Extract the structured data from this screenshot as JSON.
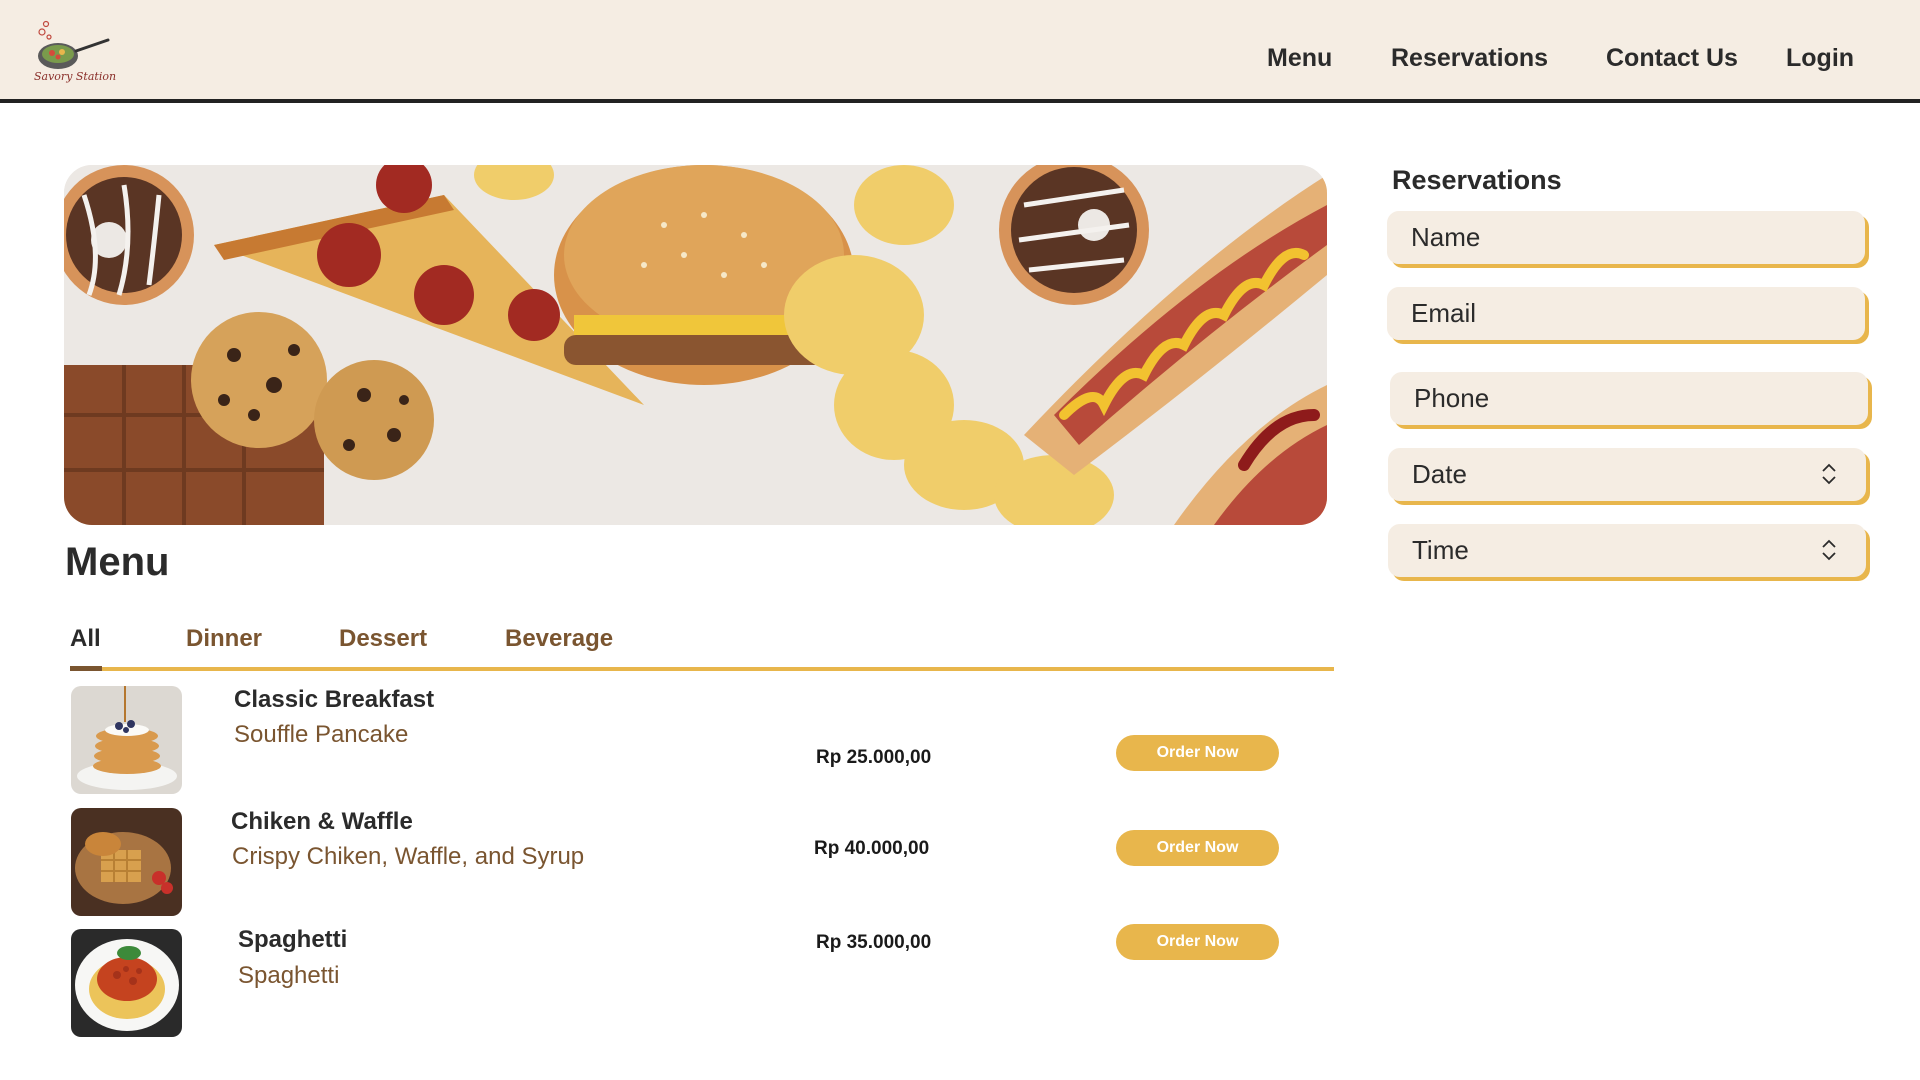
{
  "header": {
    "logo_text": "Savory Station",
    "nav": [
      "Menu",
      "Reservations",
      "Contact Us",
      "Login"
    ]
  },
  "menu": {
    "title": "Menu",
    "tabs": [
      "All",
      "Dinner",
      "Dessert",
      "Beverage"
    ],
    "active_tab": "All",
    "items": [
      {
        "name": "Classic Breakfast",
        "description": "Souffle Pancake",
        "price": "Rp 25.000,00",
        "button": "Order Now",
        "image": "pancake-image"
      },
      {
        "name": "Chiken & Waffle",
        "description": "Crispy Chiken, Waffle, and Syrup",
        "price": "Rp 40.000,00",
        "button": "Order Now",
        "image": "chicken-waffle-image"
      },
      {
        "name": "Spaghetti",
        "description": "Spaghetti",
        "price": "Rp 35.000,00",
        "button": "Order Now",
        "image": "spaghetti-image"
      }
    ]
  },
  "reservations": {
    "title": "Reservations",
    "fields": {
      "name": "Name",
      "email": "Email",
      "phone": "Phone",
      "date": "Date",
      "time": "Time"
    }
  },
  "colors": {
    "header_bg": "#f5ede3",
    "accent": "#e8b64c",
    "brown": "#7a5530",
    "dark": "#2b2b2b"
  },
  "icons": {
    "logo": "frying-pan-logo-icon",
    "select": "up-down-chevron-icon"
  }
}
